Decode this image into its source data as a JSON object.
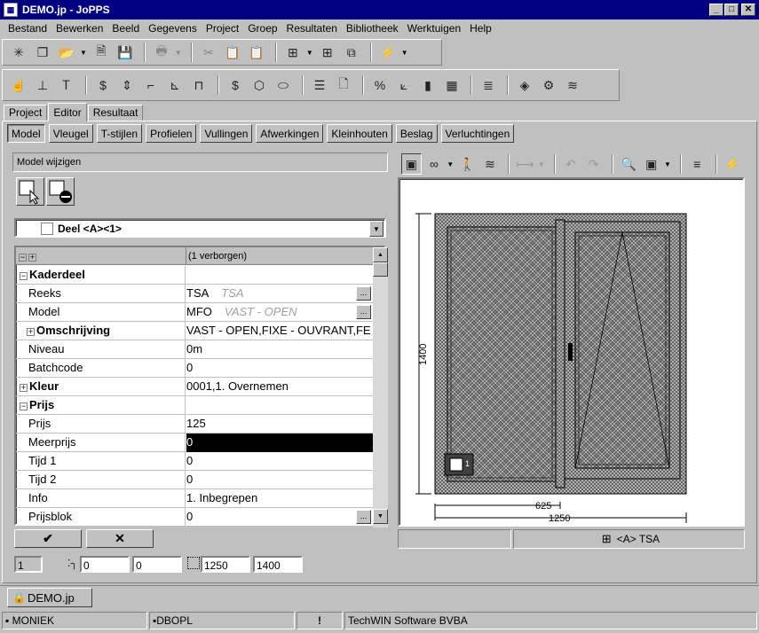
{
  "window": {
    "title": "DEMO.jp - JoPPS",
    "minimize": "_",
    "maximize": "□",
    "close": "✕"
  },
  "menu": [
    "Bestand",
    "Bewerken",
    "Beeld",
    "Gegevens",
    "Project",
    "Groep",
    "Resultaten",
    "Bibliotheek",
    "Werktuigen",
    "Help"
  ],
  "main_tabs": [
    "Project",
    "Editor",
    "Resultaat"
  ],
  "sub_tabs": [
    "Model",
    "Vleugel",
    "T-stijlen",
    "Profielen",
    "Vullingen",
    "Afwerkingen",
    "Kleinhouten",
    "Beslag",
    "Verluchtingen"
  ],
  "model_panel": {
    "label": "Model wijzigen"
  },
  "deel_select": {
    "value": "Deel <A><1>"
  },
  "grid": {
    "header_value": "(1 verborgen)",
    "rows": [
      {
        "name": "Kaderdeel",
        "value": "",
        "type": "section",
        "toggle": "−"
      },
      {
        "name": "Reeks",
        "value": "TSA",
        "ghost": "TSA",
        "ellipsis": true
      },
      {
        "name": "Model",
        "value": "MFO",
        "ghost": "VAST - OPEN",
        "ellipsis": true
      },
      {
        "name": "Omschrijving",
        "value": "VAST - OPEN,FIXE - OUVRANT,FE",
        "type": "expandable",
        "toggle": "+"
      },
      {
        "name": "Niveau",
        "value": "0m"
      },
      {
        "name": "Batchcode",
        "value": "0"
      },
      {
        "name": "Kleur",
        "value": "0001,1. Overnemen",
        "type": "section",
        "toggle": "+"
      },
      {
        "name": "Prijs",
        "value": "",
        "type": "section",
        "toggle": "−"
      },
      {
        "name": "Prijs",
        "value": "125"
      },
      {
        "name": "Meerprijs",
        "value": "0",
        "selected": true
      },
      {
        "name": "Tijd 1",
        "value": "0"
      },
      {
        "name": "Tijd 2",
        "value": "0"
      },
      {
        "name": "Info",
        "value": "1. Inbegrepen"
      },
      {
        "name": "Prijsblok",
        "value": "0",
        "ellipsis": true
      }
    ]
  },
  "buttons": {
    "ok": "✔",
    "cancel": "✕",
    "ellipsis": "..."
  },
  "fields": {
    "index": "1",
    "x": "0",
    "y": "0",
    "width": "1250",
    "height": "1400"
  },
  "drawing": {
    "height_label": "1400",
    "partial_width": "625",
    "total_width": "1250",
    "panel_label": "1",
    "status_text": "<A> TSA"
  },
  "document_tab": "DEMO.jp",
  "statusbar": {
    "user": "MONIEK",
    "database": "DBOPL",
    "alert": "!",
    "company": "TechWIN Software BVBA"
  }
}
